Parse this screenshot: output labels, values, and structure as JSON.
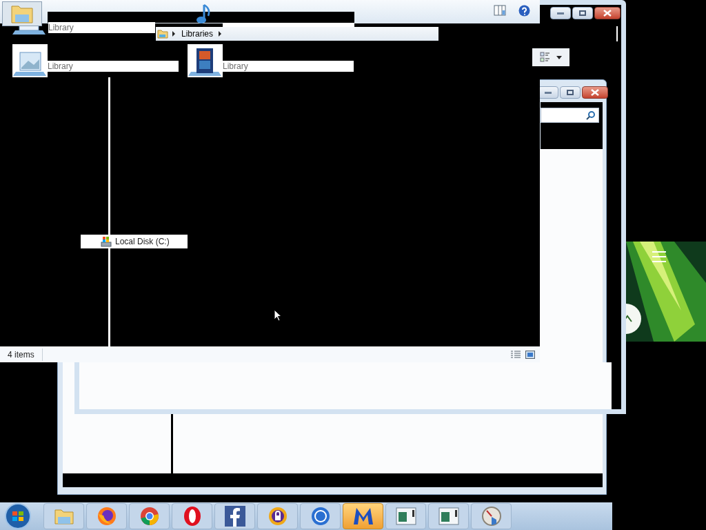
{
  "library_tiles": [
    {
      "label": "Library",
      "kind": "documents"
    },
    {
      "label": "Library",
      "kind": "pictures"
    },
    {
      "label": "Library",
      "kind": "videos"
    }
  ],
  "breadcrumb": {
    "segments": [
      "Libraries"
    ]
  },
  "navigation_pane": {
    "items": [
      {
        "label": "Local Disk (C:)"
      }
    ]
  },
  "status_bar": {
    "item_count": "4 items"
  },
  "taskbar": {
    "items": [
      {
        "kind": "folder",
        "selected": false
      },
      {
        "kind": "firefox",
        "selected": false
      },
      {
        "kind": "chrome",
        "selected": false
      },
      {
        "kind": "opera",
        "selected": false
      },
      {
        "kind": "facebook",
        "selected": false
      },
      {
        "kind": "vpn",
        "selected": false
      },
      {
        "kind": "ur",
        "selected": false
      },
      {
        "kind": "malware",
        "selected": true
      },
      {
        "kind": "window",
        "selected": false
      },
      {
        "kind": "window",
        "selected": false
      },
      {
        "kind": "gauge",
        "selected": false
      }
    ]
  }
}
